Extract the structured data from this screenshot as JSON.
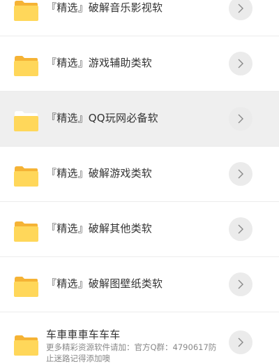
{
  "items": [
    {
      "label": "『精选』破解音乐影视软"
    },
    {
      "label": "『精选』游戏辅助类软"
    },
    {
      "label": "『精选』QQ玩网必备软"
    },
    {
      "label": "『精选』破解游戏类软"
    },
    {
      "label": "『精选』破解其他类软"
    },
    {
      "label": "『精选』破解图壁纸类软"
    },
    {
      "label": "车車車車车车车",
      "subtitle": "更多精彩资源软件请加：官方Q群：4790617防止迷路记得添加噢"
    }
  ],
  "icons": {
    "folder": "folder-icon",
    "arrow": "chevron-right-icon"
  },
  "colors": {
    "folder_body": "#ffd75a",
    "folder_tab": "#f5b335",
    "row_highlight": "#efefef",
    "arrow_bg": "#ebebeb"
  }
}
